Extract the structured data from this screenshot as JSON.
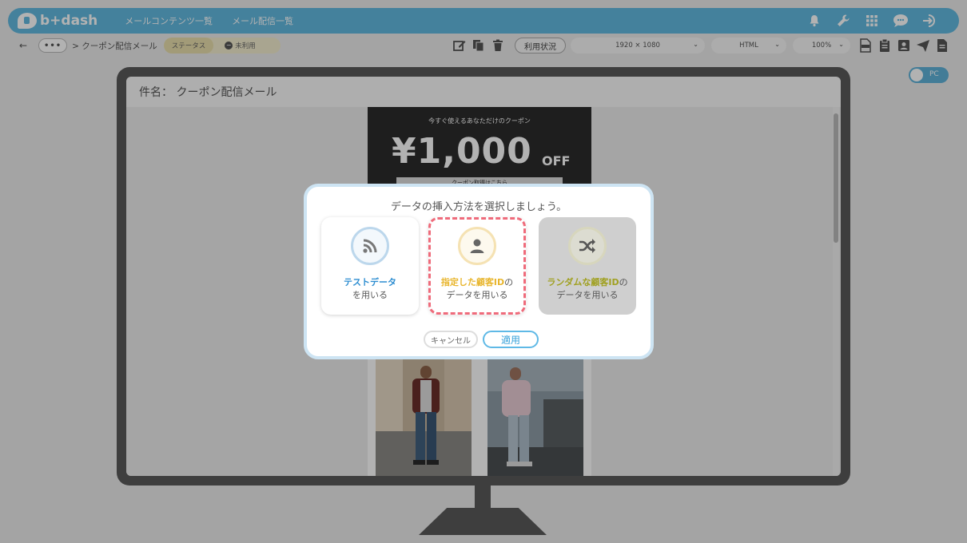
{
  "header": {
    "logo_text": "b+dash",
    "nav": [
      "メールコンテンツ一覧",
      "メール配信一覧"
    ],
    "icons": [
      "bell-icon",
      "wrench-icon",
      "grid-icon",
      "chat-icon",
      "logout-icon"
    ]
  },
  "toolbar": {
    "back": "←",
    "more": "•••",
    "breadcrumb": "> クーポン配信メール",
    "status_label": "ステータス",
    "status_value": "未利用",
    "usage_button": "利用状況",
    "resolution": "1920 × 1080",
    "format": "HTML",
    "zoom": "100%",
    "action_icons": [
      "edit-icon",
      "copy-icon",
      "trash-icon"
    ],
    "right_icons": [
      "html-file-icon",
      "clipboard-icon",
      "contact-icon",
      "send-icon",
      "document-icon"
    ]
  },
  "preview": {
    "toggle_label": "PC",
    "subject": "件名： クーポン配信メール",
    "coupon_title": "今すぐ使えるあなただけのクーポン",
    "coupon_amount": "¥1,000",
    "coupon_off": "OFF",
    "coupon_button": "クーポン取得はこちら"
  },
  "modal": {
    "title": "データの挿入方法を選択しましょう。",
    "options": [
      {
        "highlight": "テストデータ",
        "suffix": "",
        "line2": "を用いる",
        "icon": "rss-icon",
        "color": "#2e8ed1"
      },
      {
        "highlight": "指定した顧客ID",
        "suffix": "の",
        "line2": "データを用いる",
        "icon": "person-icon",
        "color": "#e8b52c"
      },
      {
        "highlight": "ランダムな顧客ID",
        "suffix": "の",
        "line2": "データを用いる",
        "icon": "shuffle-icon",
        "color": "#a0a020"
      }
    ],
    "cancel_label": "キャンセル",
    "apply_label": "適用"
  },
  "colors": {
    "accent": "#62b9e0",
    "highlight_border": "#ef6b7b"
  }
}
